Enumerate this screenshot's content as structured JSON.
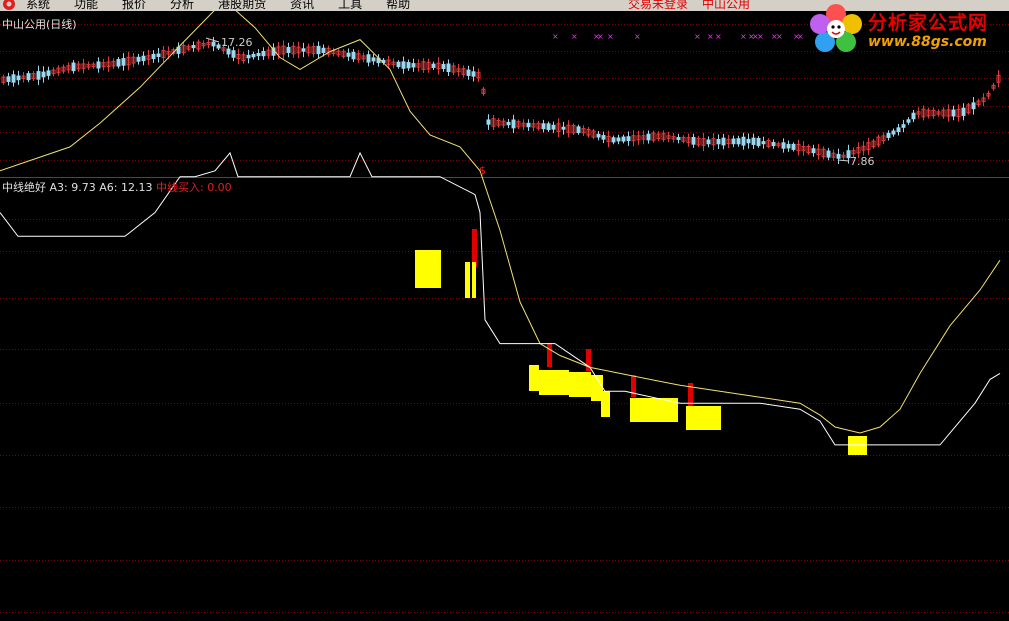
{
  "menu": {
    "items": [
      "系统",
      "功能",
      "报价",
      "分析",
      "港股期货",
      "资讯",
      "工具",
      "帮助"
    ],
    "status": [
      "交易未登录",
      "中山公用"
    ]
  },
  "brand": {
    "name": "分析家公式网",
    "url": "www.88gs.com"
  },
  "price_chart": {
    "title": "中山公用(日线)",
    "high_label": "17.26",
    "low_label": "7.86",
    "marker": "$"
  },
  "indicator": {
    "name": "中线绝好",
    "a3_label": "A3:",
    "a3_value": "9.73",
    "a6_label": "A6:",
    "a6_value": "12.13",
    "buy_label": "中线买入:",
    "buy_value": "0.00"
  },
  "colors": {
    "background": "#000000",
    "grid": "#7a0000",
    "candle_up": "#e03a3a",
    "candle_down": "#9ad8f0",
    "a6_line": "#f0e070",
    "a3_line": "#ffffff",
    "signal": "#ffff00",
    "buy_bar": "#e00000",
    "magenta_mark": "#e040e0"
  },
  "chart_data": {
    "type": "line",
    "series": [
      {
        "name": "A6",
        "x": [
          0,
          70,
          100,
          140,
          180,
          215,
          235,
          255,
          280,
          300,
          330,
          360,
          390,
          410,
          430,
          460,
          480,
          500,
          520,
          540,
          560,
          590,
          620,
          650,
          680,
          720,
          760,
          800,
          820,
          835,
          860,
          880,
          900,
          920,
          950,
          980,
          1000
        ],
        "values": [
          13.2,
          13.6,
          14.0,
          14.6,
          15.3,
          15.9,
          15.9,
          15.6,
          15.1,
          14.9,
          15.2,
          15.4,
          14.9,
          14.2,
          13.8,
          13.6,
          13.2,
          12.2,
          11.0,
          10.3,
          10.1,
          9.9,
          9.8,
          9.7,
          9.6,
          9.5,
          9.4,
          9.3,
          9.1,
          8.9,
          8.8,
          8.9,
          9.2,
          9.8,
          10.6,
          11.2,
          11.7
        ]
      },
      {
        "name": "A3",
        "x": [
          0,
          18,
          125,
          155,
          180,
          195,
          215,
          230,
          238,
          290,
          350,
          360,
          372,
          410,
          440,
          475,
          480,
          485,
          500,
          525,
          555,
          590,
          605,
          625,
          680,
          720,
          760,
          800,
          820,
          835,
          860,
          940,
          960,
          975,
          990,
          1000
        ],
        "values": [
          12.5,
          12.1,
          12.1,
          12.5,
          13.1,
          13.1,
          13.2,
          13.5,
          13.1,
          13.1,
          13.1,
          13.5,
          13.1,
          13.1,
          13.1,
          12.8,
          12.5,
          10.7,
          10.3,
          10.3,
          10.3,
          9.9,
          9.5,
          9.5,
          9.3,
          9.3,
          9.3,
          9.2,
          9.0,
          8.6,
          8.6,
          8.6,
          9.0,
          9.3,
          9.7,
          9.8
        ]
      }
    ]
  }
}
